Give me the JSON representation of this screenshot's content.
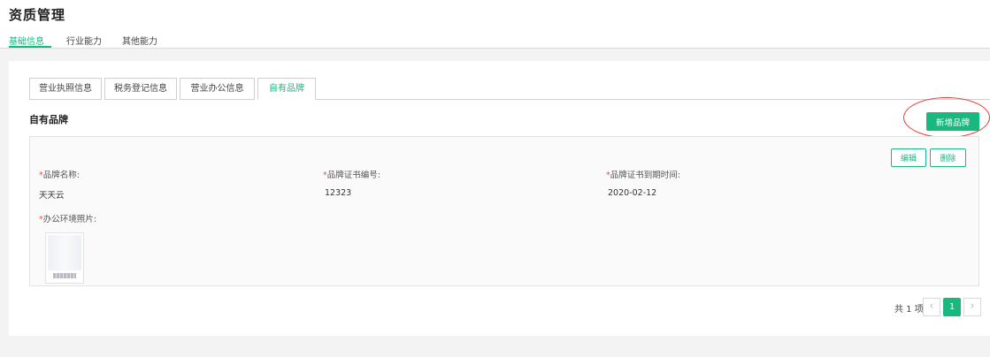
{
  "page": {
    "title": "资质管理"
  },
  "top_tabs": [
    {
      "label": "基础信息",
      "active": true
    },
    {
      "label": "行业能力",
      "active": false
    },
    {
      "label": "其他能力",
      "active": false
    }
  ],
  "sub_tabs": [
    {
      "label": "营业执照信息",
      "active": false
    },
    {
      "label": "税务登记信息",
      "active": false
    },
    {
      "label": "营业办公信息",
      "active": false
    },
    {
      "label": "自有品牌",
      "active": true
    }
  ],
  "section": {
    "title": "自有品牌",
    "add_button": "新增品牌"
  },
  "card": {
    "edit_button": "编辑",
    "delete_button": "删除",
    "required_mark": "*",
    "fields": [
      {
        "label": "品牌名称:",
        "value": "天天云"
      },
      {
        "label": "品牌证书编号:",
        "value": "12323"
      },
      {
        "label": "品牌证书到期时间:",
        "value": "2020-02-12"
      }
    ],
    "photo_label": "办公环境照片:"
  },
  "pagination": {
    "total": "共 1 项",
    "prev_icon": "‹",
    "current": "1",
    "next_icon": "›"
  },
  "colors": {
    "accent": "#19b87e",
    "required": "#e5533e",
    "annotation": "#e53935"
  },
  "icons": [
    "chevron-left-icon",
    "chevron-right-icon"
  ]
}
